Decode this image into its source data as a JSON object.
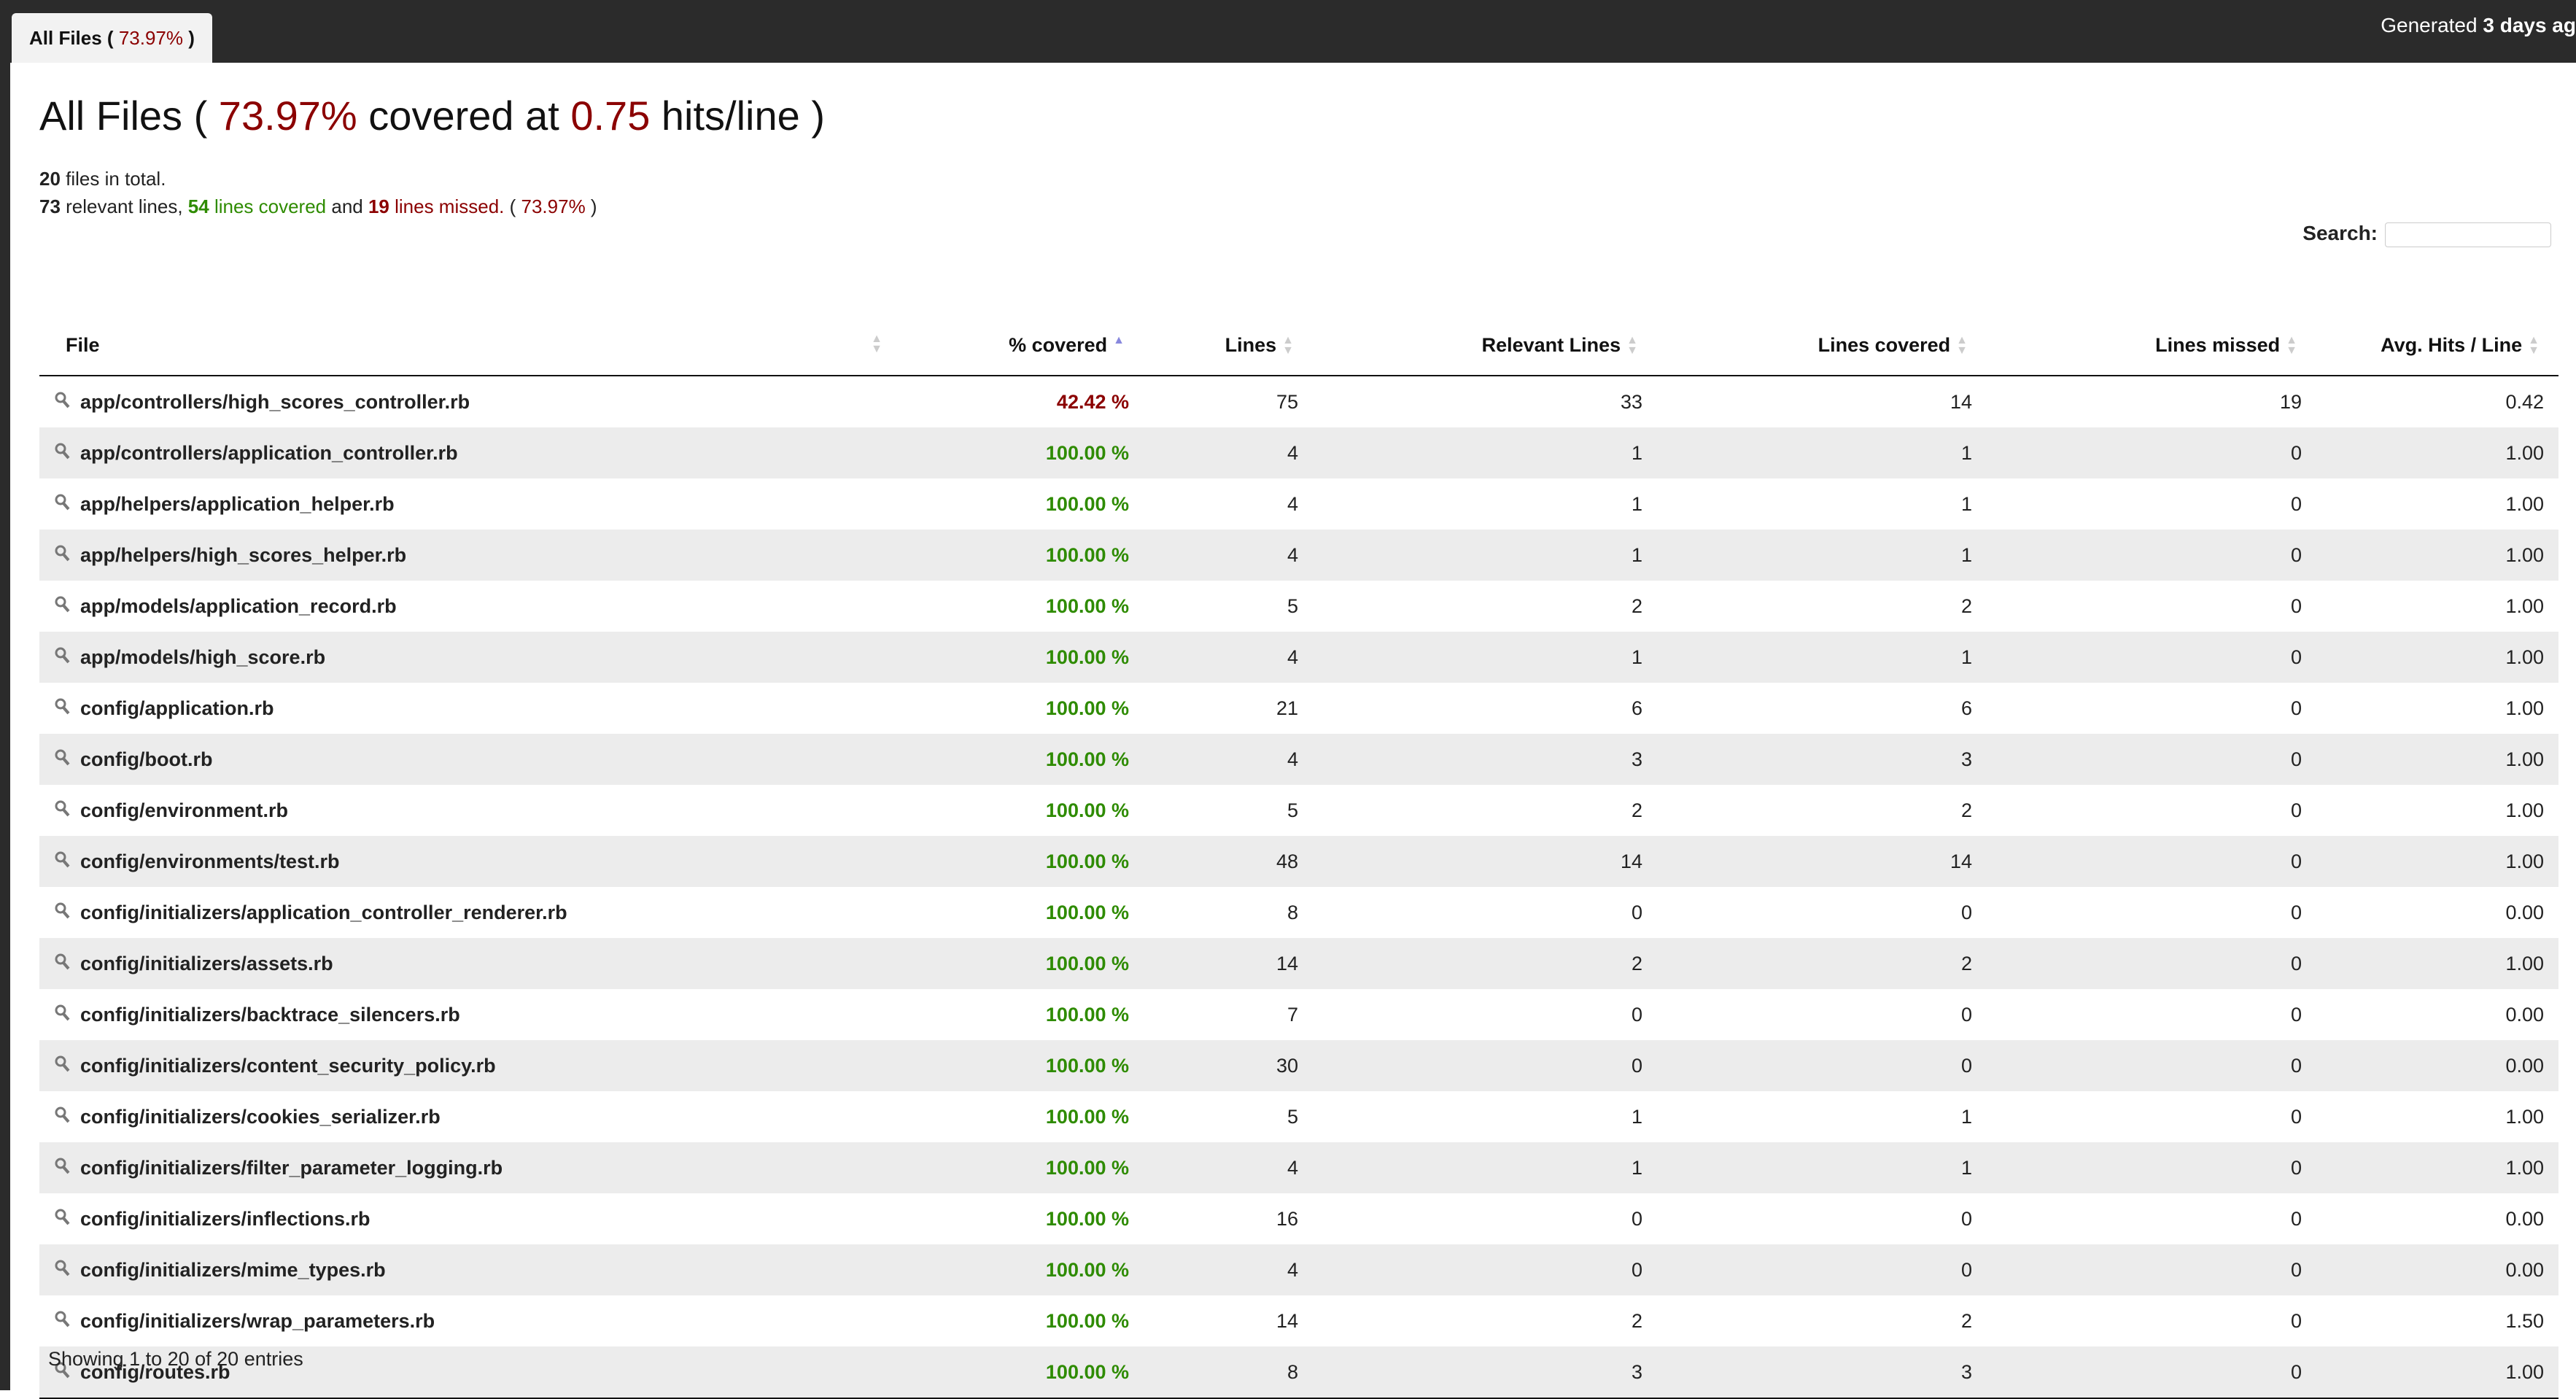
{
  "topbar": {
    "tab_label_prefix": "All Files ( ",
    "tab_percent": "73.97%",
    "tab_label_suffix": " )",
    "generated_prefix": "Generated ",
    "generated_time": "3 days ag"
  },
  "heading": {
    "prefix": "All Files ( ",
    "percent": "73.97%",
    "middle": " covered at ",
    "hits": "0.75",
    "suffix": " hits/line )"
  },
  "summary": {
    "files_count": "20",
    "files_text": " files in total.",
    "relevant": "73",
    "relevant_text": " relevant lines, ",
    "covered_count": "54",
    "covered_text": " lines covered",
    "and_text": " and ",
    "missed_count": "19",
    "missed_text": " lines missed.",
    "percent_open": " ( ",
    "percent": "73.97%",
    "percent_close": " )"
  },
  "search": {
    "label": "Search:",
    "value": ""
  },
  "table": {
    "headers": [
      "File",
      "% covered",
      "Lines",
      "Relevant Lines",
      "Lines covered",
      "Lines missed",
      "Avg. Hits / Line"
    ],
    "rows": [
      {
        "file": "app/controllers/high_scores_controller.rb",
        "covered": "42.42 %",
        "lines": "75",
        "relevant": "33",
        "lines_covered": "14",
        "missed": "19",
        "avg": "0.42",
        "status": "low"
      },
      {
        "file": "app/controllers/application_controller.rb",
        "covered": "100.00 %",
        "lines": "4",
        "relevant": "1",
        "lines_covered": "1",
        "missed": "0",
        "avg": "1.00",
        "status": "good"
      },
      {
        "file": "app/helpers/application_helper.rb",
        "covered": "100.00 %",
        "lines": "4",
        "relevant": "1",
        "lines_covered": "1",
        "missed": "0",
        "avg": "1.00",
        "status": "good"
      },
      {
        "file": "app/helpers/high_scores_helper.rb",
        "covered": "100.00 %",
        "lines": "4",
        "relevant": "1",
        "lines_covered": "1",
        "missed": "0",
        "avg": "1.00",
        "status": "good"
      },
      {
        "file": "app/models/application_record.rb",
        "covered": "100.00 %",
        "lines": "5",
        "relevant": "2",
        "lines_covered": "2",
        "missed": "0",
        "avg": "1.00",
        "status": "good"
      },
      {
        "file": "app/models/high_score.rb",
        "covered": "100.00 %",
        "lines": "4",
        "relevant": "1",
        "lines_covered": "1",
        "missed": "0",
        "avg": "1.00",
        "status": "good"
      },
      {
        "file": "config/application.rb",
        "covered": "100.00 %",
        "lines": "21",
        "relevant": "6",
        "lines_covered": "6",
        "missed": "0",
        "avg": "1.00",
        "status": "good"
      },
      {
        "file": "config/boot.rb",
        "covered": "100.00 %",
        "lines": "4",
        "relevant": "3",
        "lines_covered": "3",
        "missed": "0",
        "avg": "1.00",
        "status": "good"
      },
      {
        "file": "config/environment.rb",
        "covered": "100.00 %",
        "lines": "5",
        "relevant": "2",
        "lines_covered": "2",
        "missed": "0",
        "avg": "1.00",
        "status": "good"
      },
      {
        "file": "config/environments/test.rb",
        "covered": "100.00 %",
        "lines": "48",
        "relevant": "14",
        "lines_covered": "14",
        "missed": "0",
        "avg": "1.00",
        "status": "good"
      },
      {
        "file": "config/initializers/application_controller_renderer.rb",
        "covered": "100.00 %",
        "lines": "8",
        "relevant": "0",
        "lines_covered": "0",
        "missed": "0",
        "avg": "0.00",
        "status": "good"
      },
      {
        "file": "config/initializers/assets.rb",
        "covered": "100.00 %",
        "lines": "14",
        "relevant": "2",
        "lines_covered": "2",
        "missed": "0",
        "avg": "1.00",
        "status": "good"
      },
      {
        "file": "config/initializers/backtrace_silencers.rb",
        "covered": "100.00 %",
        "lines": "7",
        "relevant": "0",
        "lines_covered": "0",
        "missed": "0",
        "avg": "0.00",
        "status": "good"
      },
      {
        "file": "config/initializers/content_security_policy.rb",
        "covered": "100.00 %",
        "lines": "30",
        "relevant": "0",
        "lines_covered": "0",
        "missed": "0",
        "avg": "0.00",
        "status": "good"
      },
      {
        "file": "config/initializers/cookies_serializer.rb",
        "covered": "100.00 %",
        "lines": "5",
        "relevant": "1",
        "lines_covered": "1",
        "missed": "0",
        "avg": "1.00",
        "status": "good"
      },
      {
        "file": "config/initializers/filter_parameter_logging.rb",
        "covered": "100.00 %",
        "lines": "4",
        "relevant": "1",
        "lines_covered": "1",
        "missed": "0",
        "avg": "1.00",
        "status": "good"
      },
      {
        "file": "config/initializers/inflections.rb",
        "covered": "100.00 %",
        "lines": "16",
        "relevant": "0",
        "lines_covered": "0",
        "missed": "0",
        "avg": "0.00",
        "status": "good"
      },
      {
        "file": "config/initializers/mime_types.rb",
        "covered": "100.00 %",
        "lines": "4",
        "relevant": "0",
        "lines_covered": "0",
        "missed": "0",
        "avg": "0.00",
        "status": "good"
      },
      {
        "file": "config/initializers/wrap_parameters.rb",
        "covered": "100.00 %",
        "lines": "14",
        "relevant": "2",
        "lines_covered": "2",
        "missed": "0",
        "avg": "1.50",
        "status": "good"
      },
      {
        "file": "config/routes.rb",
        "covered": "100.00 %",
        "lines": "8",
        "relevant": "3",
        "lines_covered": "3",
        "missed": "0",
        "avg": "1.00",
        "status": "good"
      }
    ]
  },
  "footer": {
    "text": "Showing 1 to 20 of 20 entries"
  },
  "colors": {
    "missed_red": "#8b0000",
    "covered_green": "#2e8b00",
    "topbar": "#2b2b2b"
  },
  "icons": {
    "file_row": "magnifier-icon",
    "sort": "sort-arrows-icon"
  }
}
